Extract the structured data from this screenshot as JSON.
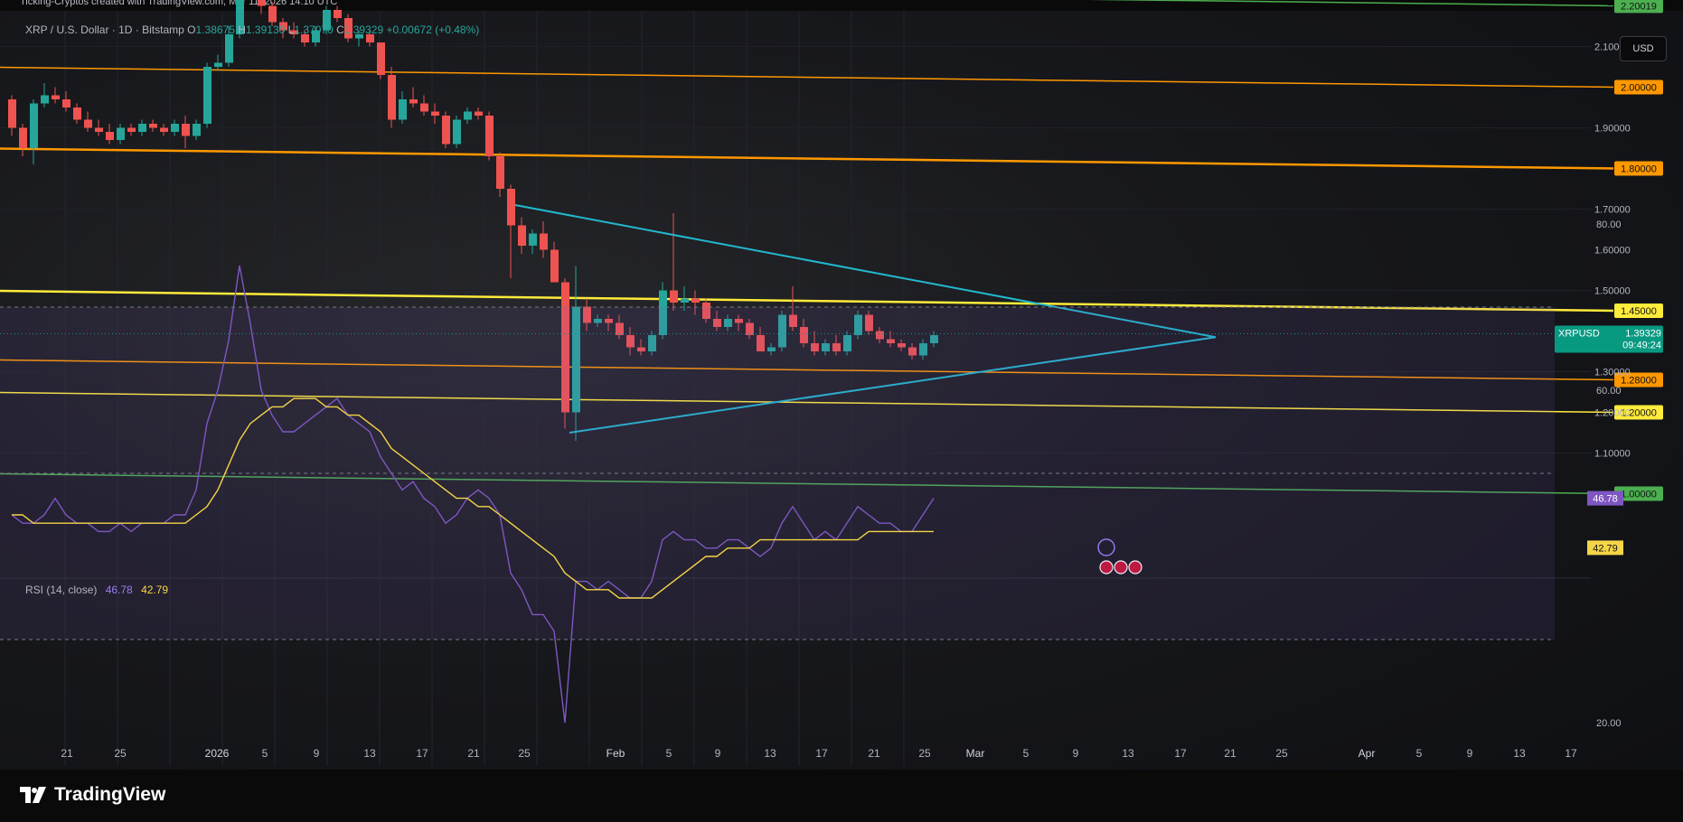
{
  "header": {
    "attribution": "Ticking-Cryptos created with TradingView.com, Mar 11, 2026 14:10 UTC"
  },
  "legend": {
    "symbol": "XRP / U.S. Dollar · 1D · Bitstamp",
    "open_label": "O",
    "open": "1.38675",
    "high_label": "H",
    "high": "1.39130",
    "low_label": "L",
    "low": "1.37070",
    "close_label": "C",
    "close": "1.39329",
    "change": "+0.00672 (+0.48%)"
  },
  "currency_button": "USD",
  "price_scale": [
    "2.10000",
    "1.90000",
    "1.70000",
    "1.60000",
    "1.50000",
    "1.30000",
    "1.20000",
    "1.10000"
  ],
  "level_labels": [
    {
      "text": "2.20019",
      "color": "#4caf50"
    },
    {
      "text": "2.00000",
      "color": "#ff9800"
    },
    {
      "text": "1.80000",
      "color": "#ff9800"
    },
    {
      "text": "1.45000",
      "color": "#ffeb3b"
    },
    {
      "text": "1.28000",
      "color": "#ff9800"
    },
    {
      "text": "1.20000",
      "color": "#ffeb3b"
    },
    {
      "text": "1.00000",
      "color": "#4caf50"
    }
  ],
  "price_tag": {
    "symbol": "XRPUSD",
    "price": "1.39329",
    "countdown": "09:49:24",
    "color": "#089981"
  },
  "rsi": {
    "label": "RSI (14, close)",
    "value": "46.78",
    "ma_value": "42.79",
    "scale": [
      "80.00",
      "60.00",
      "20.00"
    ],
    "rsi_color": "#7e57c2",
    "ma_color": "#f5d547"
  },
  "time_axis": [
    "21",
    "25",
    "2026",
    "5",
    "9",
    "13",
    "17",
    "21",
    "25",
    "Feb",
    "5",
    "9",
    "13",
    "17",
    "21",
    "25",
    "Mar",
    "5",
    "9",
    "13",
    "17",
    "21",
    "25",
    "Apr",
    "5",
    "9",
    "13",
    "17"
  ],
  "footer": {
    "brand": "TradingView"
  },
  "chart_data": {
    "type": "candlestick",
    "symbol": "XRPUSD",
    "timeframe": "1D",
    "exchange": "Bitstamp",
    "candle_colors": {
      "up": "#26a69a",
      "down": "#ef5350"
    },
    "candles": [
      [
        1.97,
        1.98,
        1.88,
        1.9
      ],
      [
        1.9,
        1.91,
        1.83,
        1.85
      ],
      [
        1.85,
        1.97,
        1.81,
        1.96
      ],
      [
        1.96,
        2.01,
        1.95,
        1.98
      ],
      [
        1.98,
        2.0,
        1.96,
        1.97
      ],
      [
        1.97,
        1.99,
        1.94,
        1.95
      ],
      [
        1.95,
        1.96,
        1.91,
        1.92
      ],
      [
        1.92,
        1.94,
        1.89,
        1.9
      ],
      [
        1.9,
        1.92,
        1.88,
        1.89
      ],
      [
        1.89,
        1.91,
        1.86,
        1.87
      ],
      [
        1.87,
        1.91,
        1.86,
        1.9
      ],
      [
        1.9,
        1.91,
        1.88,
        1.89
      ],
      [
        1.89,
        1.92,
        1.88,
        1.91
      ],
      [
        1.91,
        1.92,
        1.89,
        1.9
      ],
      [
        1.9,
        1.91,
        1.88,
        1.89
      ],
      [
        1.89,
        1.92,
        1.88,
        1.91
      ],
      [
        1.91,
        1.93,
        1.85,
        1.88
      ],
      [
        1.88,
        1.92,
        1.87,
        1.91
      ],
      [
        1.91,
        2.06,
        1.9,
        2.05
      ],
      [
        2.05,
        2.08,
        2.04,
        2.06
      ],
      [
        2.06,
        2.15,
        2.05,
        2.13
      ],
      [
        2.13,
        2.42,
        2.12,
        2.4
      ],
      [
        2.4,
        2.42,
        2.23,
        2.25
      ],
      [
        2.25,
        2.3,
        2.18,
        2.2
      ],
      [
        2.2,
        2.21,
        2.15,
        2.16
      ],
      [
        2.16,
        2.17,
        2.12,
        2.14
      ],
      [
        2.14,
        2.16,
        2.12,
        2.13
      ],
      [
        2.13,
        2.14,
        2.1,
        2.11
      ],
      [
        2.11,
        2.15,
        2.1,
        2.14
      ],
      [
        2.14,
        2.2,
        2.13,
        2.19
      ],
      [
        2.19,
        2.2,
        2.16,
        2.17
      ],
      [
        2.17,
        2.18,
        2.11,
        2.12
      ],
      [
        2.12,
        2.14,
        2.1,
        2.13
      ],
      [
        2.13,
        2.14,
        2.1,
        2.11
      ],
      [
        2.11,
        2.11,
        2.02,
        2.03
      ],
      [
        2.03,
        2.05,
        1.9,
        1.92
      ],
      [
        1.92,
        1.99,
        1.91,
        1.97
      ],
      [
        1.97,
        2.0,
        1.95,
        1.96
      ],
      [
        1.96,
        1.98,
        1.93,
        1.94
      ],
      [
        1.94,
        1.96,
        1.91,
        1.93
      ],
      [
        1.93,
        1.94,
        1.85,
        1.86
      ],
      [
        1.86,
        1.93,
        1.85,
        1.92
      ],
      [
        1.92,
        1.95,
        1.91,
        1.94
      ],
      [
        1.94,
        1.95,
        1.92,
        1.93
      ],
      [
        1.93,
        1.94,
        1.82,
        1.83
      ],
      [
        1.83,
        1.84,
        1.73,
        1.75
      ],
      [
        1.75,
        1.76,
        1.53,
        1.66
      ],
      [
        1.66,
        1.68,
        1.59,
        1.61
      ],
      [
        1.61,
        1.65,
        1.59,
        1.64
      ],
      [
        1.64,
        1.67,
        1.58,
        1.6
      ],
      [
        1.6,
        1.62,
        1.52,
        1.52
      ],
      [
        1.52,
        1.53,
        1.16,
        1.2
      ],
      [
        1.2,
        1.56,
        1.13,
        1.46
      ],
      [
        1.46,
        1.48,
        1.4,
        1.42
      ],
      [
        1.42,
        1.44,
        1.41,
        1.43
      ],
      [
        1.43,
        1.44,
        1.4,
        1.42
      ],
      [
        1.42,
        1.44,
        1.38,
        1.39
      ],
      [
        1.39,
        1.41,
        1.34,
        1.36
      ],
      [
        1.36,
        1.38,
        1.34,
        1.35
      ],
      [
        1.35,
        1.4,
        1.34,
        1.39
      ],
      [
        1.39,
        1.52,
        1.38,
        1.5
      ],
      [
        1.5,
        1.69,
        1.45,
        1.47
      ],
      [
        1.47,
        1.51,
        1.45,
        1.48
      ],
      [
        1.48,
        1.5,
        1.44,
        1.47
      ],
      [
        1.47,
        1.48,
        1.42,
        1.43
      ],
      [
        1.43,
        1.45,
        1.4,
        1.41
      ],
      [
        1.41,
        1.44,
        1.4,
        1.43
      ],
      [
        1.43,
        1.44,
        1.4,
        1.42
      ],
      [
        1.42,
        1.43,
        1.38,
        1.39
      ],
      [
        1.39,
        1.41,
        1.35,
        1.35
      ],
      [
        1.35,
        1.37,
        1.34,
        1.36
      ],
      [
        1.36,
        1.45,
        1.35,
        1.44
      ],
      [
        1.44,
        1.51,
        1.4,
        1.41
      ],
      [
        1.41,
        1.43,
        1.36,
        1.37
      ],
      [
        1.37,
        1.4,
        1.34,
        1.35
      ],
      [
        1.35,
        1.38,
        1.34,
        1.37
      ],
      [
        1.37,
        1.39,
        1.34,
        1.35
      ],
      [
        1.35,
        1.4,
        1.34,
        1.39
      ],
      [
        1.39,
        1.45,
        1.38,
        1.44
      ],
      [
        1.44,
        1.45,
        1.39,
        1.4
      ],
      [
        1.4,
        1.41,
        1.37,
        1.38
      ],
      [
        1.38,
        1.4,
        1.36,
        1.37
      ],
      [
        1.37,
        1.38,
        1.35,
        1.36
      ],
      [
        1.36,
        1.37,
        1.33,
        1.34
      ],
      [
        1.34,
        1.38,
        1.33,
        1.37
      ],
      [
        1.37,
        1.4,
        1.36,
        1.39
      ]
    ],
    "horizontal_levels": [
      2.20019,
      2.0,
      1.8,
      1.45,
      1.28,
      1.2,
      1.0
    ],
    "triangle_pattern": {
      "upper_line": {
        "from_price": 1.71,
        "to_price": 1.385
      },
      "lower_line": {
        "from_price": 1.15,
        "to_price": 1.385
      },
      "apex_price": 1.385
    },
    "rsi_series": [
      45,
      44,
      44,
      45,
      47,
      45,
      44,
      44,
      43,
      43,
      44,
      43,
      44,
      44,
      44,
      45,
      45,
      48,
      56,
      60,
      66,
      75,
      68,
      60,
      57,
      55,
      55,
      56,
      57,
      58,
      59,
      57,
      56,
      55,
      52,
      50,
      48,
      49,
      47,
      46,
      44,
      45,
      47,
      48,
      47,
      45,
      38,
      36,
      33,
      33,
      31,
      20,
      37,
      37,
      36,
      37,
      36,
      35,
      35,
      37,
      42,
      43,
      42,
      42,
      41,
      41,
      42,
      42,
      41,
      40,
      41,
      44,
      46,
      44,
      42,
      43,
      42,
      44,
      46,
      45,
      44,
      44,
      43,
      43,
      45,
      47
    ],
    "rsi_ma_series": [
      45,
      45,
      44,
      44,
      44,
      44,
      44,
      44,
      44,
      44,
      44,
      44,
      44,
      44,
      44,
      44,
      44,
      45,
      46,
      48,
      51,
      54,
      56,
      57,
      58,
      58,
      59,
      59,
      59,
      58,
      58,
      57,
      57,
      56,
      55,
      53,
      52,
      51,
      50,
      49,
      48,
      47,
      47,
      46,
      46,
      45,
      44,
      43,
      42,
      41,
      40,
      38,
      37,
      36,
      36,
      36,
      35,
      35,
      35,
      35,
      36,
      37,
      38,
      39,
      40,
      40,
      41,
      41,
      41,
      42,
      42,
      42,
      42,
      42,
      42,
      42,
      42,
      42,
      42,
      43,
      43,
      43,
      43,
      43,
      43,
      43
    ],
    "rsi_bands": {
      "upper": 70,
      "middle": 50,
      "lower": 30
    },
    "rsi_ylim": [
      10,
      85
    ]
  }
}
